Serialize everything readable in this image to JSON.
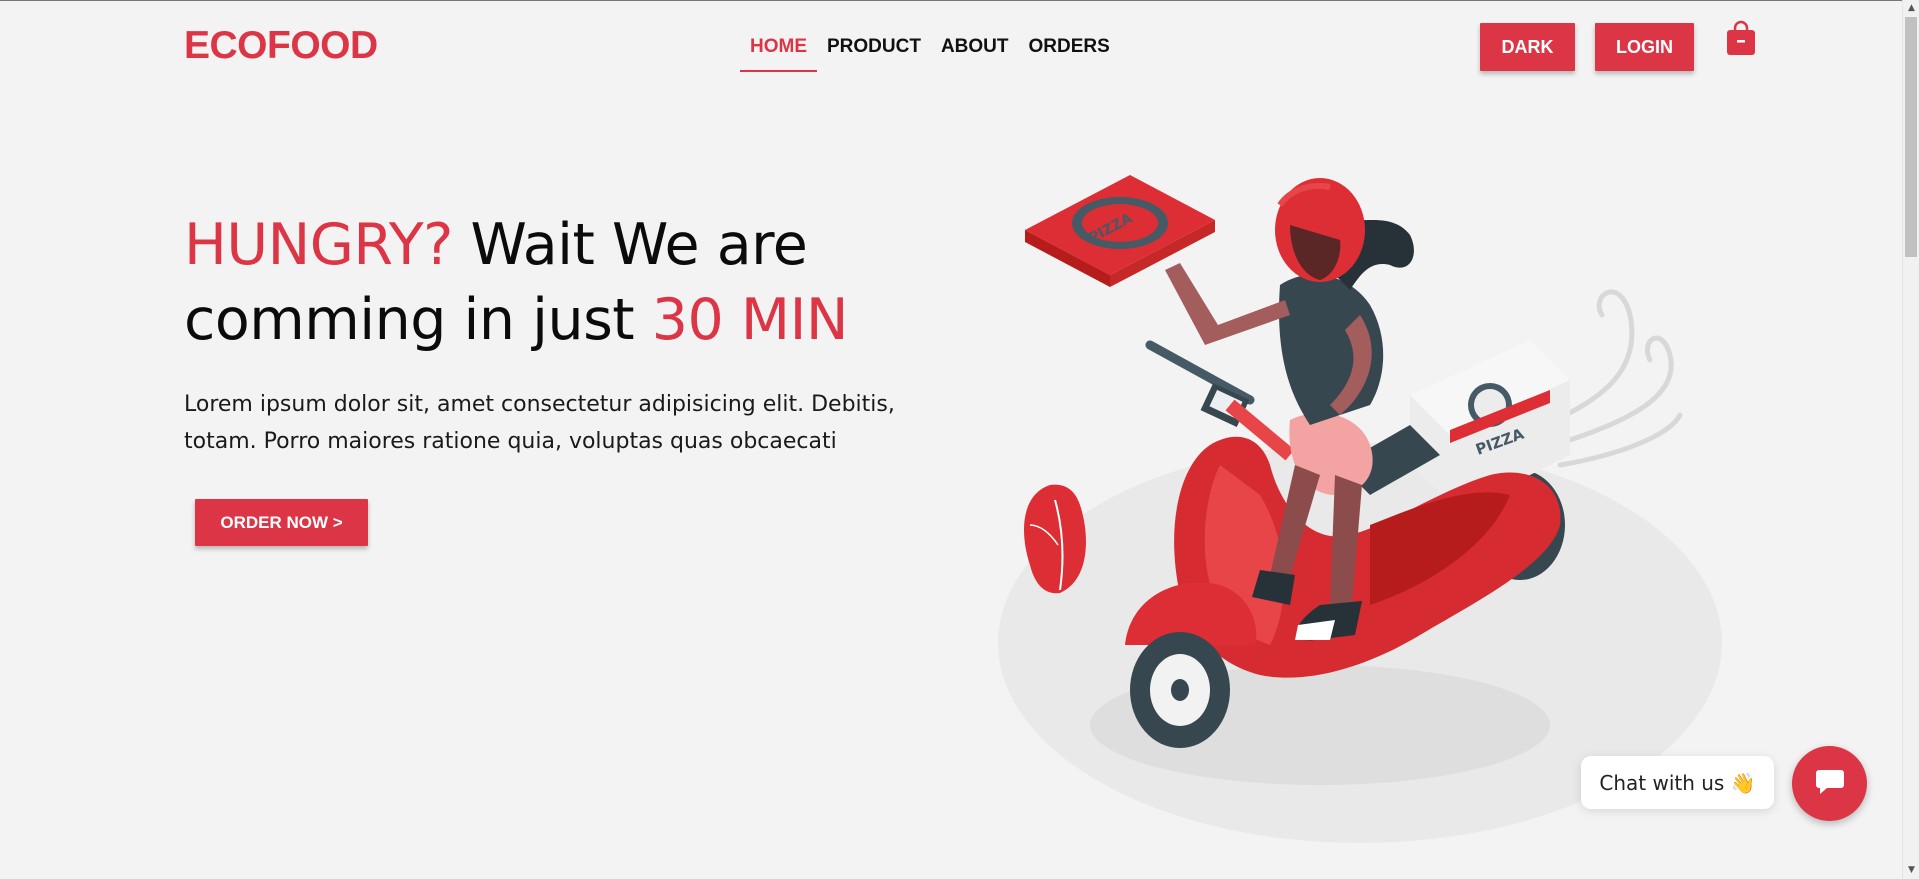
{
  "brand": {
    "logo": "ECOFOOD",
    "accent_color": "#dc3545"
  },
  "nav": {
    "items": [
      "HOME",
      "PRODUCT",
      "ABOUT",
      "ORDERS"
    ],
    "active": "HOME"
  },
  "header": {
    "dark_label": "DARK",
    "login_label": "LOGIN",
    "cart_icon": "shopping-bag-icon"
  },
  "hero": {
    "title_part1": "HUNGRY?",
    "title_part2": " Wait We are",
    "title_part3": "comming in just ",
    "title_part4": "30 MIN",
    "description": "Lorem ipsum dolor sit, amet consectetur adipisicing elit. Debitis, totam. Porro maiores ratione quia, voluptas quas obcaecati",
    "cta_label": "ORDER NOW >"
  },
  "illustration": {
    "box_text": "PIZZA"
  },
  "chat": {
    "bubble_text": "Chat with us 👋",
    "button_icon": "chat-icon"
  }
}
